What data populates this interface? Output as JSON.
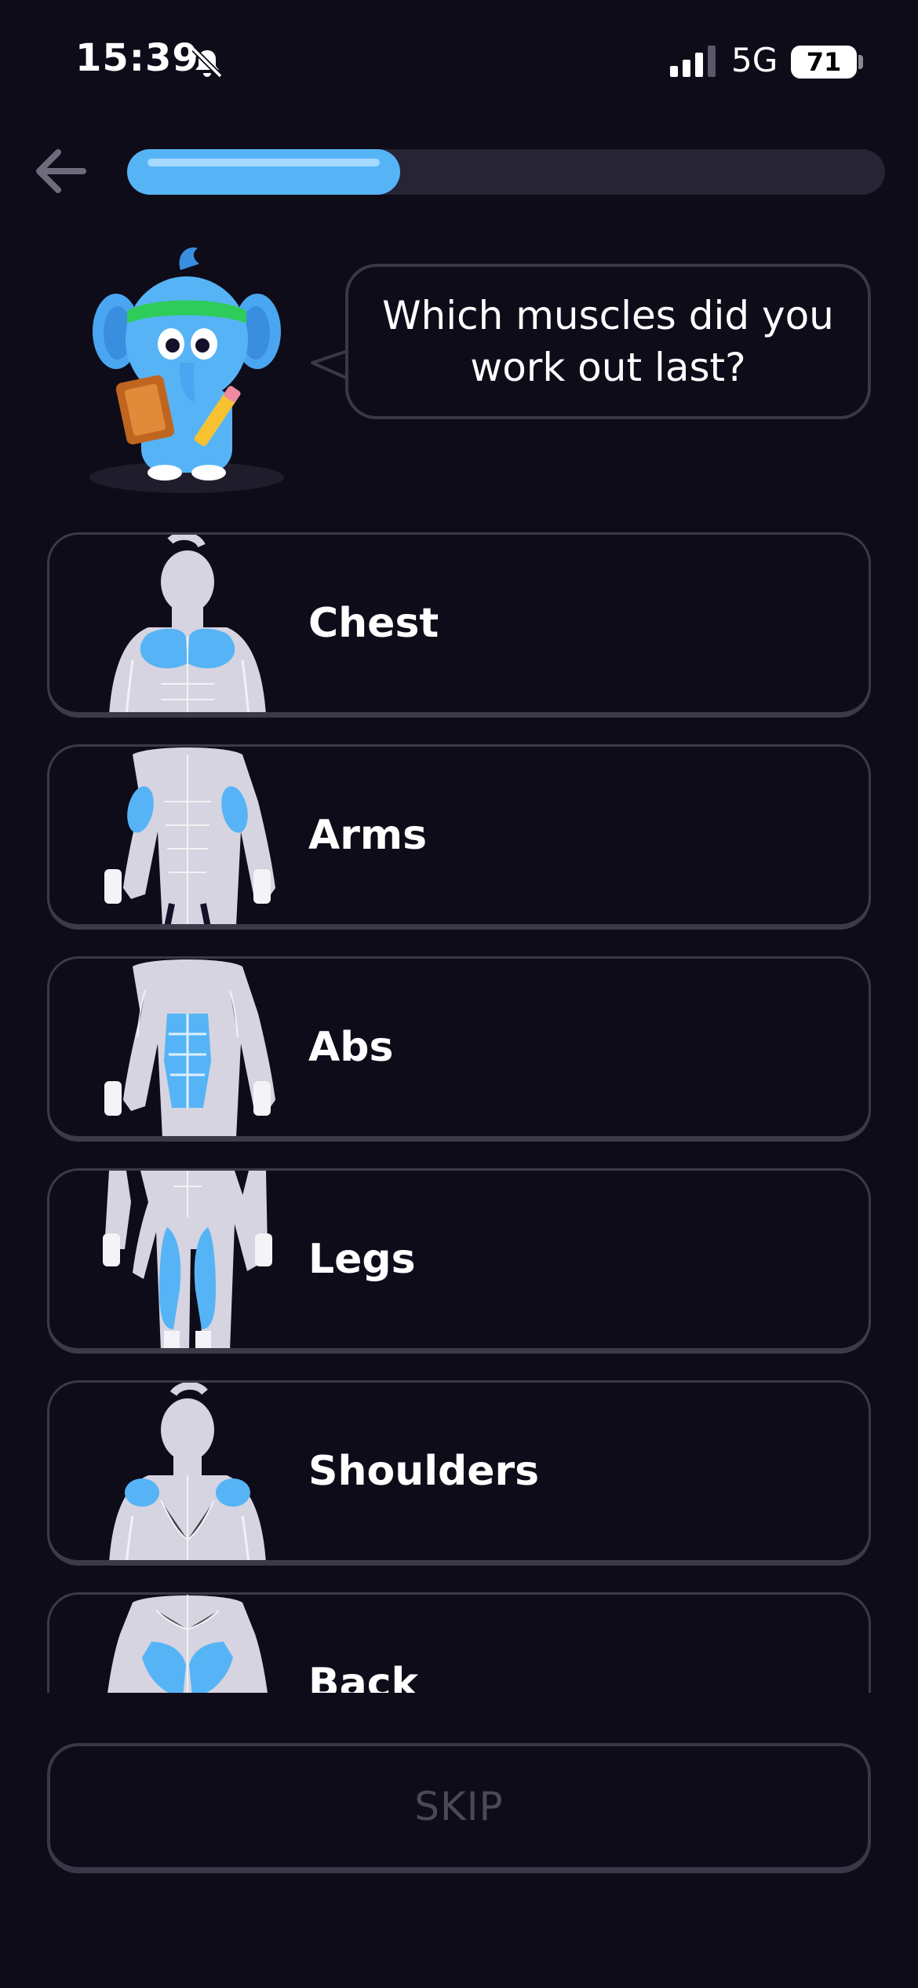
{
  "status_bar": {
    "time": "15:39",
    "network": "5G",
    "battery_level": "71",
    "icons": [
      "bell-slash-icon",
      "signal-bars-icon",
      "battery-icon"
    ]
  },
  "header": {
    "back_icon": "arrow-left-icon",
    "progress_fraction": 0.36
  },
  "prompt": {
    "question": "Which muscles did you work out last?"
  },
  "options": [
    {
      "label": "Chest",
      "figure": "front-upper-body-chest-highlight"
    },
    {
      "label": "Arms",
      "figure": "front-torso-arms-highlight"
    },
    {
      "label": "Abs",
      "figure": "front-torso-abs-highlight"
    },
    {
      "label": "Legs",
      "figure": "front-legs-highlight"
    },
    {
      "label": "Shoulders",
      "figure": "back-upper-body-shoulders-highlight"
    },
    {
      "label": "Back",
      "figure": "back-torso-lats-highlight"
    }
  ],
  "skip": {
    "label": "SKIP"
  },
  "colors": {
    "background": "#0e0c19",
    "accent": "#56b4f6",
    "card_border": "#3c3948",
    "figure_body": "#d5d4e0",
    "disabled_text": "#4b4858"
  }
}
